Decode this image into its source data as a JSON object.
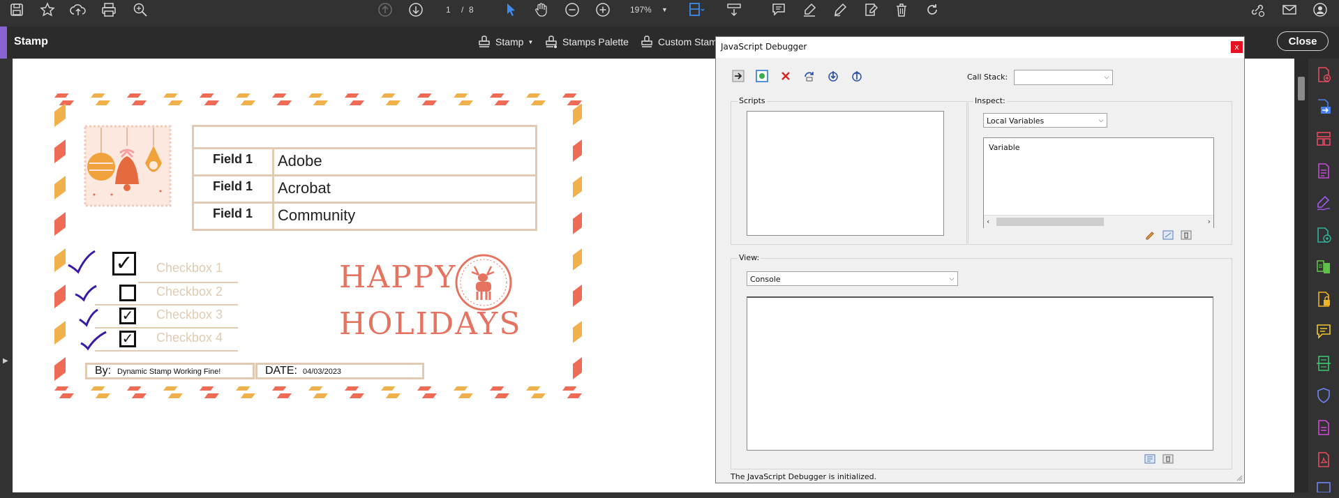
{
  "toolbar": {
    "page_current": "1",
    "page_sep": "/",
    "page_total": "8",
    "zoom": "197%"
  },
  "stampbar": {
    "title": "Stamp",
    "stamp_label": "Stamp",
    "palette_label": "Stamps Palette",
    "custom_label": "Custom Stam",
    "close_label": "Close"
  },
  "stamp_doc": {
    "fields": [
      {
        "label": "Field 1",
        "value": "Adobe"
      },
      {
        "label": "Field 1",
        "value": "Acrobat"
      },
      {
        "label": "Field 1",
        "value": "Community"
      }
    ],
    "checkboxes": [
      {
        "label": "Checkbox 1",
        "checked": true
      },
      {
        "label": "Checkbox 2",
        "checked": false
      },
      {
        "label": "Checkbox 3",
        "checked": true
      },
      {
        "label": "Checkbox 4",
        "checked": true
      }
    ],
    "greeting_line1": "HAPPY",
    "greeting_line2": "HOLIDAYS",
    "by_label": "By:",
    "by_value": "Dynamic Stamp Working Fine!",
    "date_label": "DATE:",
    "date_value": "04/03/2023",
    "colors": {
      "stripe_red": "#ee6c55",
      "stripe_yellow": "#f0b04b",
      "text_coral": "#e67260",
      "border_beige": "#e0cbb2",
      "check_purple": "#3a1aa3"
    }
  },
  "debugger": {
    "title": "JavaScript Debugger",
    "close": "x",
    "call_stack_label": "Call Stack:",
    "call_stack_value": "",
    "scripts_label": "Scripts",
    "inspect_label": "Inspect:",
    "inspect_value": "Local Variables",
    "variable_header": "Variable",
    "view_label": "View:",
    "view_value": "Console",
    "status": "The JavaScript Debugger is initialized."
  }
}
